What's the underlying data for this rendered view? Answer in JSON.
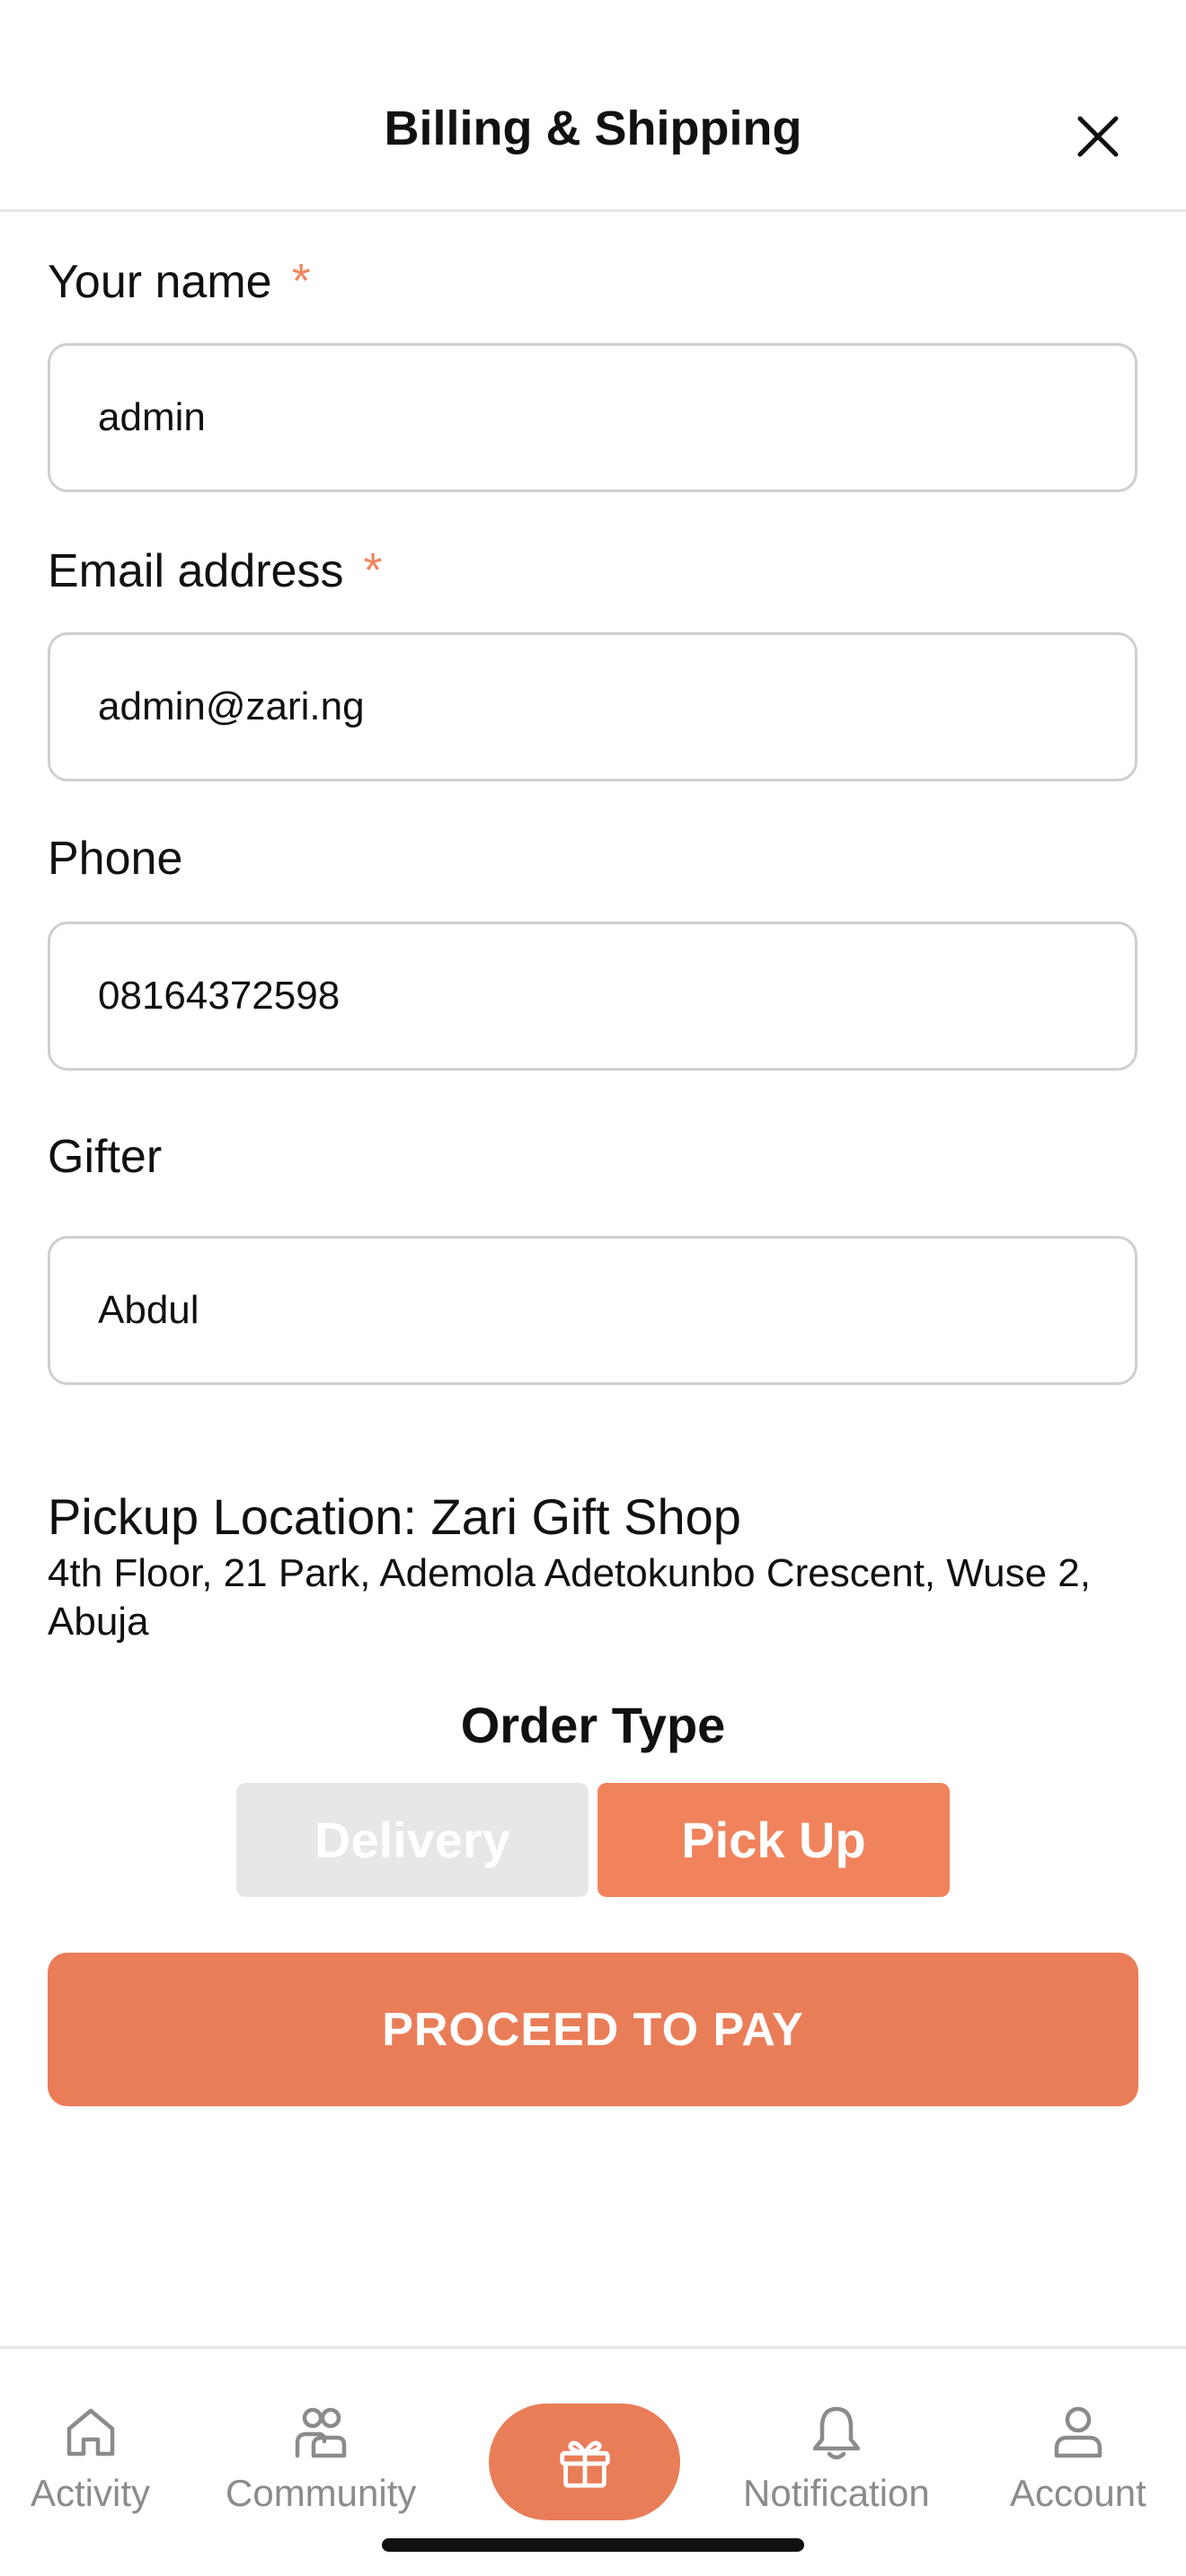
{
  "header": {
    "title": "Billing & Shipping",
    "close_icon": "close-icon"
  },
  "form": {
    "name": {
      "label": "Your name",
      "required_mark": "*",
      "value": "admin"
    },
    "email": {
      "label": "Email address",
      "required_mark": "*",
      "value": "admin@zari.ng"
    },
    "phone": {
      "label": "Phone",
      "value": "08164372598"
    },
    "gifter": {
      "label": "Gifter",
      "value": "Abdul"
    }
  },
  "pickup": {
    "title": "Pickup Location: Zari Gift Shop",
    "address": "4th Floor, 21 Park, Ademola Adetokunbo Crescent, Wuse 2, Abuja"
  },
  "order_type": {
    "title": "Order Type",
    "options": [
      "Delivery",
      "Pick Up"
    ],
    "selected": "Pick Up"
  },
  "proceed_label": "PROCEED TO PAY",
  "tabbar": {
    "items": [
      {
        "label": "Activity",
        "icon": "home-icon"
      },
      {
        "label": "Community",
        "icon": "community-icon"
      },
      {
        "label": "",
        "icon": "gift-icon"
      },
      {
        "label": "Notification",
        "icon": "bell-icon"
      },
      {
        "label": "Account",
        "icon": "user-icon"
      }
    ]
  },
  "colors": {
    "accent": "#e97d58",
    "required": "#ee8760",
    "inactive_segment": "#e7e7e9",
    "tab_label": "#8b8b8b"
  }
}
